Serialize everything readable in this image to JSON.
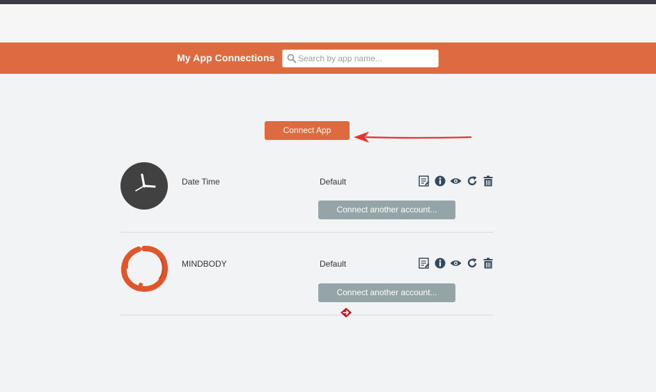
{
  "header": {
    "title": "My App Connections",
    "search_placeholder": "Search by app name..."
  },
  "connect_app_label": "Connect App",
  "connections": [
    {
      "app_name": "Date Time",
      "profile": "Default",
      "connect_another_label": "Connect another account..."
    },
    {
      "app_name": "MINDBODY",
      "profile": "Default",
      "connect_another_label": "Connect another account..."
    }
  ],
  "icons": {
    "search": "search-icon",
    "edit": "edit-icon",
    "info": "info-icon",
    "view": "eye-icon",
    "refresh": "refresh-icon",
    "delete": "trash-icon",
    "annotation_arrow": "red-arrow-icon"
  },
  "colors": {
    "accent": "#de6b40",
    "button_gray": "#95a4a6",
    "icon_dark": "#34495e",
    "annotation_red": "#e8322c"
  }
}
